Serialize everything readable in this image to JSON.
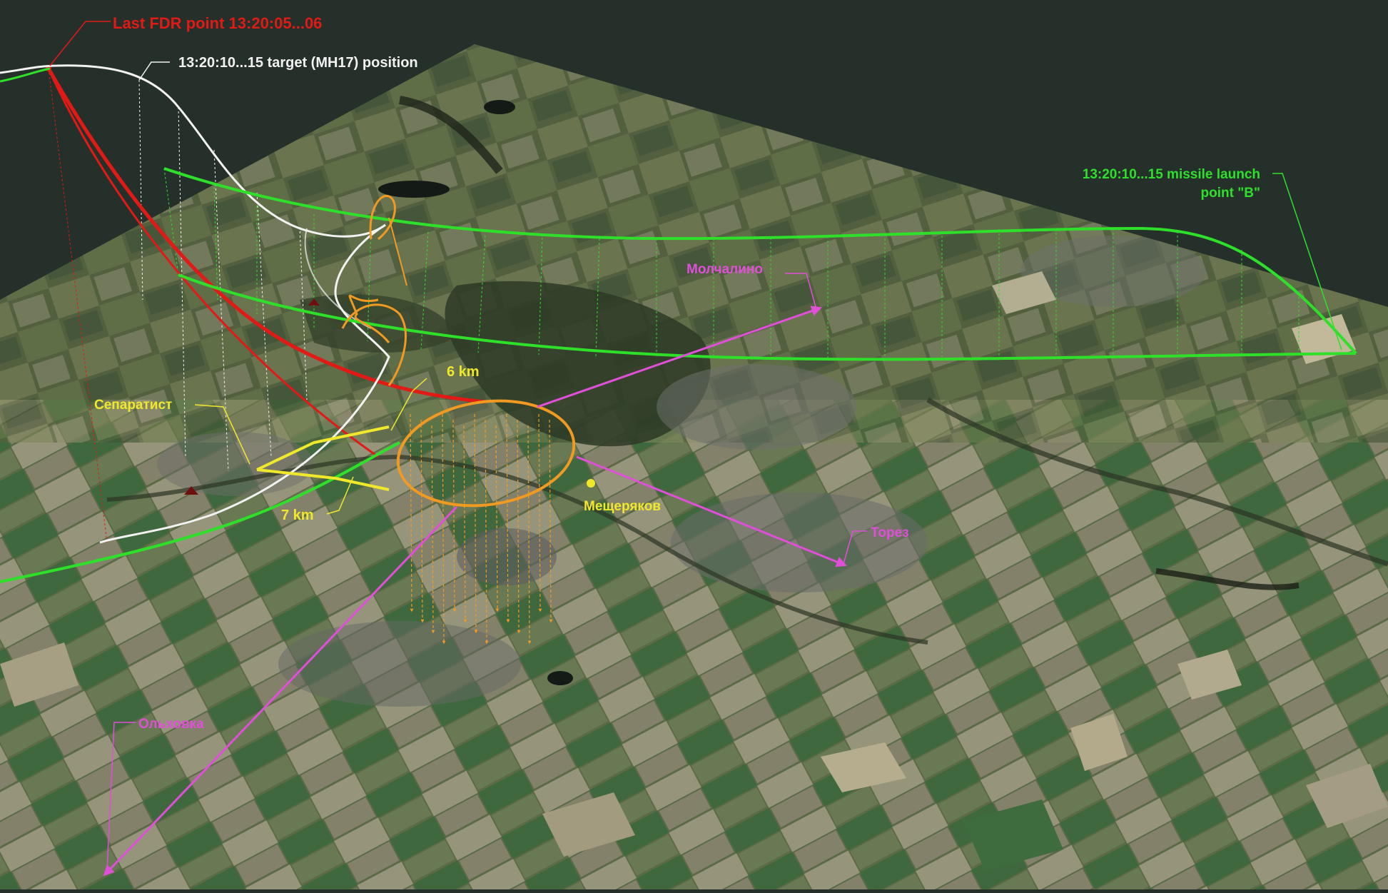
{
  "colors": {
    "sky": "#25302a",
    "terrain_base": "#4e5b42",
    "fdr_track": "#e11a16",
    "target_track": "#f2f2f2",
    "missile_track": "#2fe02a",
    "range_line": "#f0e82a",
    "locality_line": "#e04fd8",
    "ellipse": "#f09a22"
  },
  "labels": {
    "last_fdr": "Last FDR point 13:20:05...06",
    "target_position": "13:20:10...15 target (MH17) position",
    "missile_launch_line1": "13:20:10...15 missile launch",
    "missile_launch_line2": "point \"B\"",
    "range_6km": "6 km",
    "range_7km": "7 km",
    "separatist": "Сепаратист",
    "molchalino": "Молчалино",
    "meshcheryakov": "Мещеряков",
    "torez": "Торез",
    "olkhovka": "Ольховка"
  }
}
